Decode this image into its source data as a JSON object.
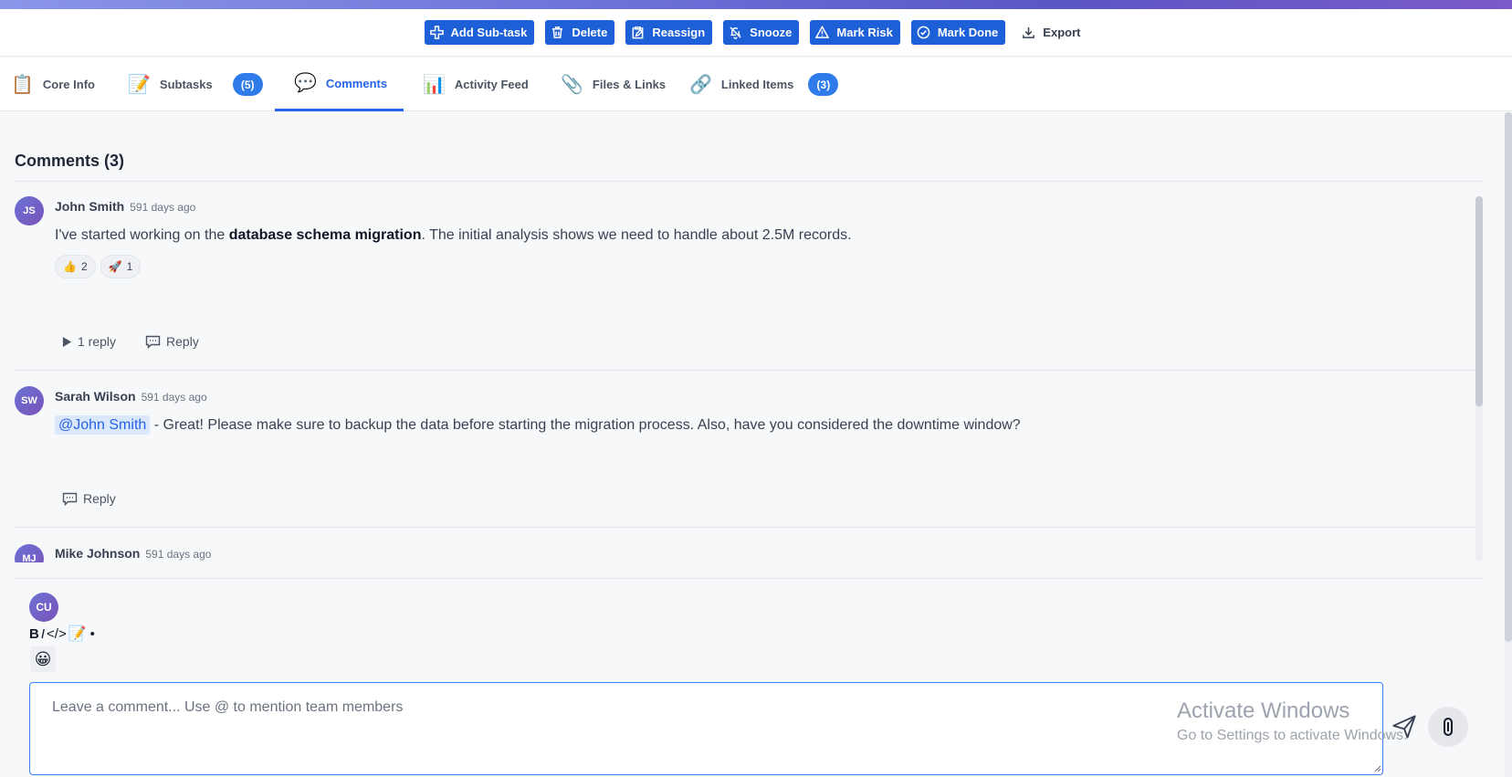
{
  "toolbar": {
    "buttons": [
      {
        "label": "Add Sub-task",
        "icon": "plus-icon"
      },
      {
        "label": "Delete",
        "icon": "trash-icon"
      },
      {
        "label": "Reassign",
        "icon": "clipboard-edit-icon"
      },
      {
        "label": "Snooze",
        "icon": "bell-off-icon"
      },
      {
        "label": "Mark Risk",
        "icon": "warning-icon"
      },
      {
        "label": "Mark Done",
        "icon": "check-circle-icon"
      },
      {
        "label": "Export",
        "icon": "download-icon"
      }
    ]
  },
  "tabs": [
    {
      "label": "Core Info",
      "icon": "📋"
    },
    {
      "label": "Subtasks",
      "icon": "📝",
      "badge": "(5)"
    },
    {
      "label": "Comments",
      "icon": "💬",
      "active": true
    },
    {
      "label": "Activity Feed",
      "icon": "📊"
    },
    {
      "label": "Files & Links",
      "icon": "📎"
    },
    {
      "label": "Linked Items",
      "icon": "🔗",
      "badge": "(3)"
    }
  ],
  "comments_section": {
    "title": "Comments (3)",
    "comments": [
      {
        "initials": "JS",
        "author": "John Smith",
        "time": "591 days ago",
        "text_before": "I've started working on the ",
        "text_bold": "database schema migration",
        "text_after": ". The initial analysis shows we need to handle about 2.5M records.",
        "reactions": [
          {
            "emoji": "👍",
            "count": "2"
          },
          {
            "emoji": "🚀",
            "count": "1"
          }
        ],
        "replies_label": "1 reply",
        "reply_label": "Reply"
      },
      {
        "initials": "SW",
        "author": "Sarah Wilson",
        "time": "591 days ago",
        "mention": "@John Smith",
        "text_after": " - Great! Please make sure to backup the data before starting the migration process. Also, have you considered the downtime window?",
        "reply_label": "Reply"
      },
      {
        "initials": "MJ",
        "author": "Mike Johnson",
        "time": "591 days ago"
      }
    ]
  },
  "composer": {
    "avatar_initials": "CU",
    "format": {
      "bold": "B",
      "italic": "I",
      "code": "</>",
      "note": "📝",
      "bullet": "•"
    },
    "emoji": "😀",
    "placeholder": "Leave a comment... Use @ to mention team members"
  },
  "watermark": {
    "title": "Activate Windows",
    "subtitle": "Go to Settings to activate Windows."
  },
  "colors": {
    "accent": "#2563eb",
    "button": "#1d5fd6",
    "avatar": "#6a72d6"
  }
}
